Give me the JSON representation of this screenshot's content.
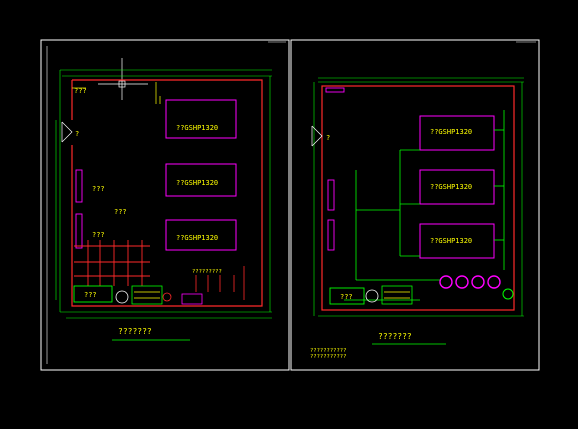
{
  "colors": {
    "background": "#000000",
    "frame": "#ffffff",
    "wall": "#ff2a2a",
    "pipe": "#00ff00",
    "equipment": "#ff00ff",
    "label": "#ffff00",
    "dim": "#00ffff"
  },
  "left_sheet": {
    "room_label": "???",
    "door_label": "?",
    "units": [
      {
        "label": "??GSHP1320"
      },
      {
        "label": "??GSHP1320"
      },
      {
        "label": "??GSHP1320"
      }
    ],
    "center_label": "???",
    "wall_labels": [
      "???",
      "???"
    ],
    "box_label": "???",
    "note_label": "?????????",
    "title": "???????"
  },
  "right_sheet": {
    "door_label": "?",
    "units": [
      {
        "label": "??GSHP1320"
      },
      {
        "label": "??GSHP1320"
      },
      {
        "label": "??GSHP1320"
      }
    ],
    "box_label": "???",
    "title": "???????",
    "notes": [
      "???????????",
      "???????????"
    ]
  }
}
